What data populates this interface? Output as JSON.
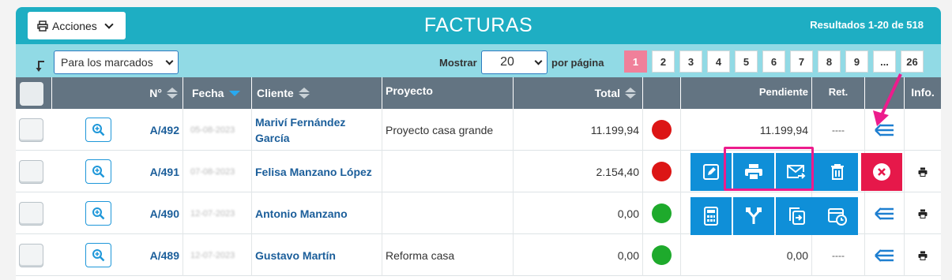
{
  "header": {
    "actions_label": "Acciones",
    "title": "FACTURAS",
    "results": "Resultados 1-20 de 518"
  },
  "filters": {
    "bulk_select_value": "Para los marcados",
    "show_label": "Mostrar",
    "per_page_value": "20",
    "per_page_label": "por página"
  },
  "pagination": [
    "1",
    "2",
    "3",
    "4",
    "5",
    "6",
    "7",
    "8",
    "9",
    "...",
    "26"
  ],
  "columns": {
    "number": "N°",
    "date": "Fecha",
    "client": "Cliente",
    "project": "Proyecto",
    "total": "Total",
    "pending": "Pendiente",
    "ret": "Ret.",
    "info": "Info."
  },
  "rows": [
    {
      "number": "A/492",
      "date": "05-08-2023",
      "client": "Mariví Fernández García",
      "project": "Proyecto casa grande",
      "total": "11.199,94",
      "status": "red",
      "pending": "11.199,94",
      "ret": "----"
    },
    {
      "number": "A/491",
      "date": "07-08-2023",
      "client": "Felisa Manzano López",
      "project": "",
      "total": "2.154,40",
      "status": "red",
      "pending": "",
      "ret": ""
    },
    {
      "number": "A/490",
      "date": "12-07-2023",
      "client": "Antonio Manzano",
      "project": "",
      "total": "0,00",
      "status": "green",
      "pending": "",
      "ret": ""
    },
    {
      "number": "A/489",
      "date": "12-07-2023",
      "client": "Gustavo Martín",
      "project": "Reforma casa",
      "total": "0,00",
      "status": "green",
      "pending": "0,00",
      "ret": "----"
    }
  ],
  "colors": {
    "title_bar": "#1eaec3",
    "filter_bar": "#91dae5",
    "header": "#637482",
    "action_blue": "#0f8fd8",
    "action_red": "#e6184a",
    "highlight": "#ec1c8c",
    "pagination_active": "#f0809a"
  },
  "icons": [
    "printer-icon",
    "chevron-down-icon",
    "bend-arrow-icon",
    "zoom-in-icon",
    "edit-icon",
    "print-icon",
    "email-send-icon",
    "trash-icon",
    "close-circle-icon",
    "calculator-icon",
    "fork-icon",
    "copy-export-icon",
    "schedule-icon",
    "list-arrow-icon"
  ]
}
